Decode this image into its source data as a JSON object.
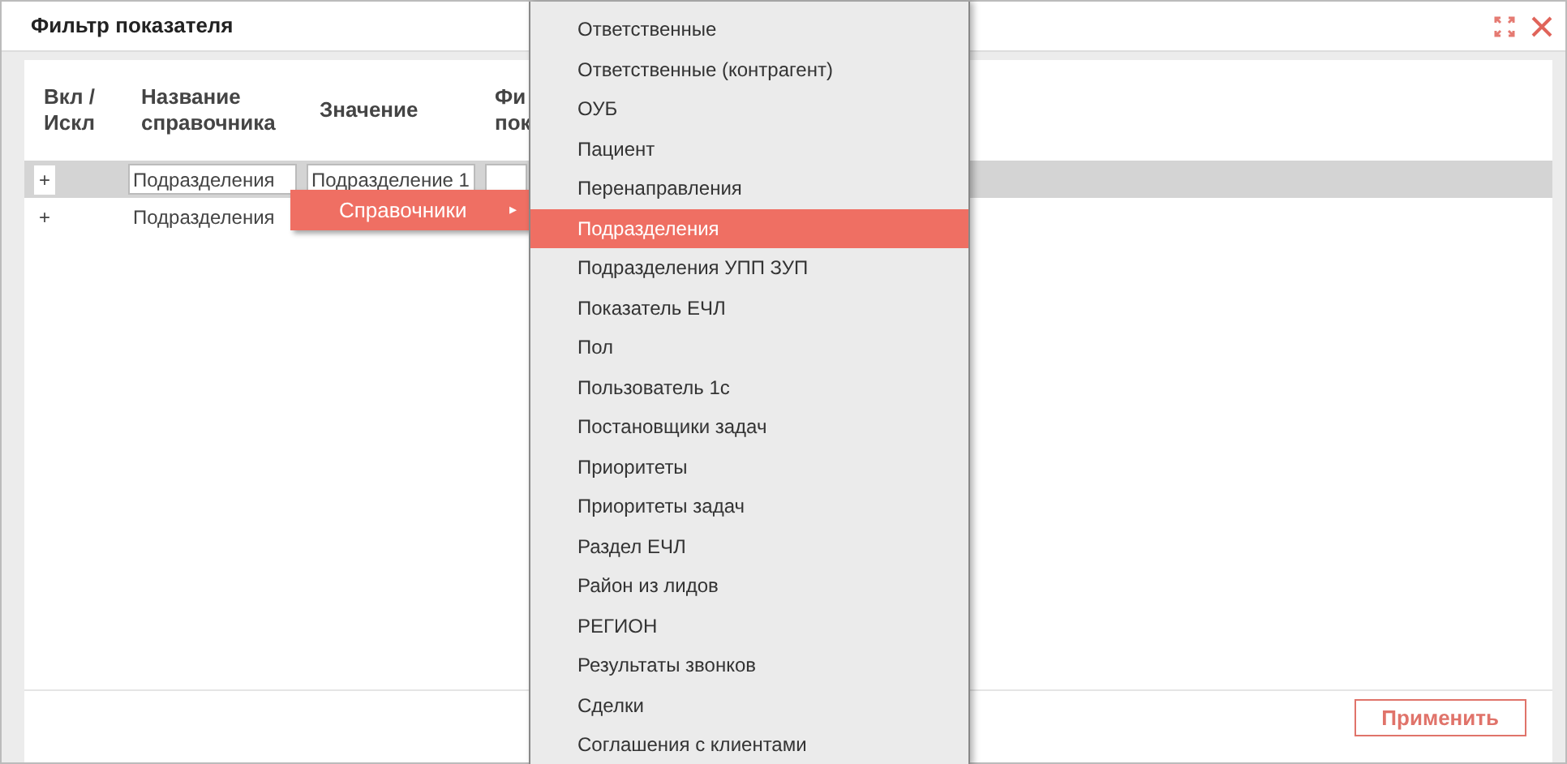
{
  "window": {
    "title": "Фильтр показателя"
  },
  "table": {
    "columns": [
      {
        "lines": [
          "Вкл /",
          "Искл"
        ]
      },
      {
        "lines": [
          "Название",
          "справочника"
        ]
      },
      {
        "lines": [
          "Значение"
        ]
      },
      {
        "lines": [
          "Фи",
          "пок"
        ]
      }
    ],
    "rows": [
      {
        "toggle": "+",
        "selected": true,
        "directory": "Подразделения",
        "value": "Подразделение 1",
        "editing": true
      },
      {
        "toggle": "+",
        "selected": false,
        "directory": "Подразделения",
        "value": "",
        "editing": false
      }
    ]
  },
  "context_menu": {
    "label": "Справочники",
    "arrow": "▸"
  },
  "submenu": {
    "items": [
      {
        "label": "Ответственные",
        "selected": false
      },
      {
        "label": "Ответственные (контрагент)",
        "selected": false
      },
      {
        "label": "ОУБ",
        "selected": false
      },
      {
        "label": "Пациент",
        "selected": false
      },
      {
        "label": "Перенаправления",
        "selected": false
      },
      {
        "label": "Подразделения",
        "selected": true
      },
      {
        "label": "Подразделения УПП ЗУП",
        "selected": false
      },
      {
        "label": "Показатель ЕЧЛ",
        "selected": false
      },
      {
        "label": "Пол",
        "selected": false
      },
      {
        "label": "Пользователь 1с",
        "selected": false
      },
      {
        "label": "Постановщики задач",
        "selected": false
      },
      {
        "label": "Приоритеты",
        "selected": false
      },
      {
        "label": "Приоритеты задач",
        "selected": false
      },
      {
        "label": "Раздел ЕЧЛ",
        "selected": false
      },
      {
        "label": "Район из лидов",
        "selected": false
      },
      {
        "label": "РЕГИОН",
        "selected": false
      },
      {
        "label": "Результаты звонков",
        "selected": false
      },
      {
        "label": "Сделки",
        "selected": false
      },
      {
        "label": "Соглашения с клиентами",
        "selected": false
      }
    ]
  },
  "footer": {
    "apply_button": "Применить"
  }
}
